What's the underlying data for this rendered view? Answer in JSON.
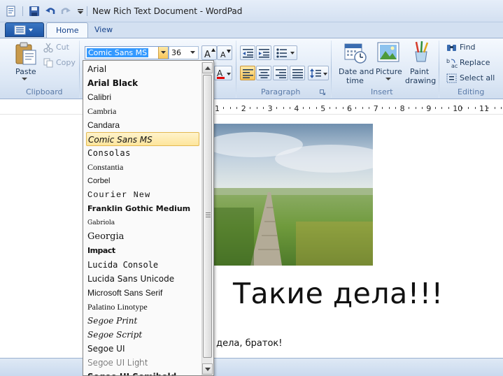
{
  "window": {
    "title": "New Rich Text Document - WordPad"
  },
  "quick_access": {
    "icons": [
      "wordpad-icon",
      "save-icon",
      "undo-icon",
      "redo-icon",
      "customize-dropdown-icon"
    ]
  },
  "ribbon": {
    "tabs": [
      {
        "label": "Home",
        "active": true
      },
      {
        "label": "View",
        "active": false
      }
    ],
    "clipboard": {
      "paste_label": "Paste",
      "cut_label": "Cut",
      "copy_label": "Copy",
      "group_label": "Clipboard"
    },
    "font": {
      "family": "Comic Sans MS",
      "size": "36"
    },
    "paragraph": {
      "group_label": "Paragraph"
    },
    "insert": {
      "date_time_label": "Date and\ntime",
      "date_label": "Date and",
      "time_label": "time",
      "picture_label": "Picture",
      "paint_label": "Paint",
      "drawing_label": "drawing",
      "group_label": "Insert"
    },
    "editing": {
      "find_label": "Find",
      "replace_label": "Replace",
      "select_all_label": "Select all",
      "group_label": "Editing"
    }
  },
  "ruler": {
    "numbers": [
      "1",
      "2",
      "3",
      "4",
      "5",
      "6",
      "7",
      "8",
      "9",
      "10",
      "11"
    ]
  },
  "document": {
    "big_text": "Такие дела!!!",
    "small_text": "е дела, браток!"
  },
  "font_dropdown": {
    "items": [
      {
        "name": "Arial"
      },
      {
        "name": "Arial Black"
      },
      {
        "name": "Calibri"
      },
      {
        "name": "Cambria"
      },
      {
        "name": "Candara"
      },
      {
        "name": "Comic Sans MS",
        "selected": true
      },
      {
        "name": "Consolas"
      },
      {
        "name": "Constantia"
      },
      {
        "name": "Corbel"
      },
      {
        "name": "Courier New"
      },
      {
        "name": "Franklin Gothic Medium"
      },
      {
        "name": "Gabriola"
      },
      {
        "name": "Georgia"
      },
      {
        "name": "Impact"
      },
      {
        "name": "Lucida Console"
      },
      {
        "name": "Lucida Sans Unicode"
      },
      {
        "name": "Microsoft Sans Serif"
      },
      {
        "name": "Palatino Linotype"
      },
      {
        "name": "Segoe Print"
      },
      {
        "name": "Segoe Script"
      },
      {
        "name": "Segoe UI"
      },
      {
        "name": "Segoe UI Light"
      },
      {
        "name": "Segoe UI Semibold"
      }
    ]
  }
}
